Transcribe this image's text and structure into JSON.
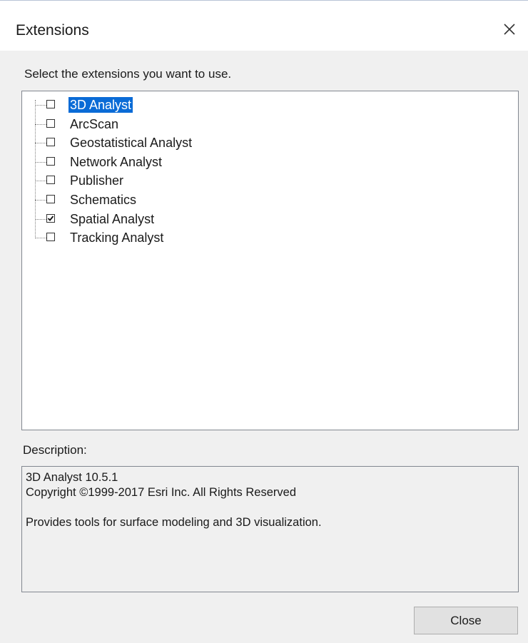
{
  "window": {
    "title": "Extensions",
    "close_icon": "close-icon"
  },
  "instruction": "Select the extensions you want to use.",
  "extensions": [
    {
      "label": "3D Analyst",
      "checked": false,
      "selected": true
    },
    {
      "label": "ArcScan",
      "checked": false,
      "selected": false
    },
    {
      "label": "Geostatistical Analyst",
      "checked": false,
      "selected": false
    },
    {
      "label": "Network Analyst",
      "checked": false,
      "selected": false
    },
    {
      "label": "Publisher",
      "checked": false,
      "selected": false
    },
    {
      "label": "Schematics",
      "checked": false,
      "selected": false
    },
    {
      "label": "Spatial Analyst",
      "checked": true,
      "selected": false
    },
    {
      "label": "Tracking Analyst",
      "checked": false,
      "selected": false
    }
  ],
  "description": {
    "label": "Description:",
    "lines": [
      "3D Analyst 10.5.1",
      "Copyright ©1999-2017 Esri Inc. All Rights Reserved",
      "",
      "Provides tools for surface modeling and 3D visualization."
    ]
  },
  "buttons": {
    "close_label": "Close"
  },
  "colors": {
    "selection": "#0a6bd6",
    "dialog_bg": "#f0f0f0",
    "border": "#828790"
  }
}
